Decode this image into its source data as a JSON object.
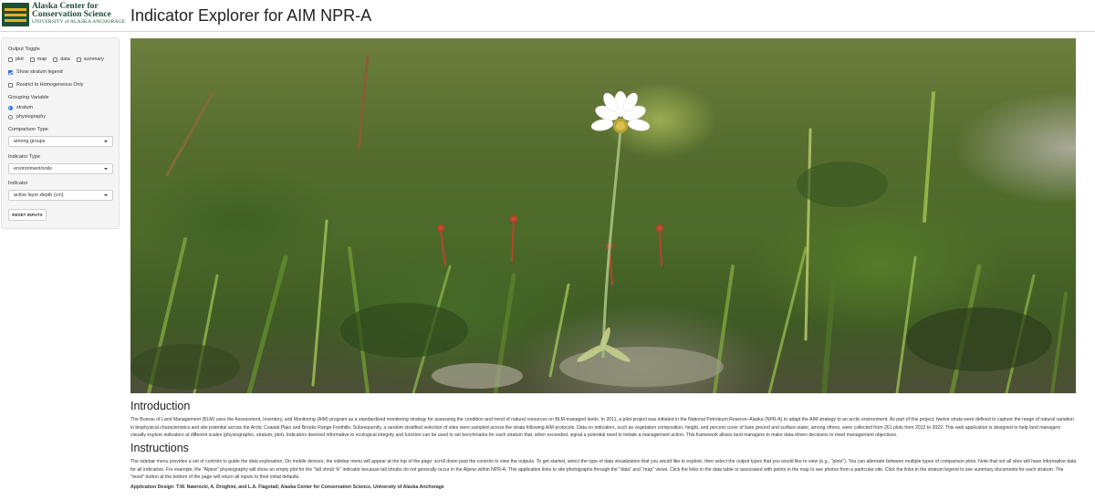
{
  "header": {
    "logo": {
      "mark_text": "UAA",
      "line1": "Alaska Center for",
      "line2": "Conservation Science",
      "line3": "UNIVERSITY of ALASKA ANCHORAGE"
    },
    "title": "Indicator Explorer for AIM NPR-A"
  },
  "sidebar": {
    "output_toggle": {
      "label": "Output Toggle",
      "options": [
        {
          "label": "plot",
          "checked": false
        },
        {
          "label": "map",
          "checked": false
        },
        {
          "label": "data",
          "checked": false
        },
        {
          "label": "summary",
          "checked": false
        }
      ]
    },
    "show_legend": {
      "label": "Show stratum legend",
      "checked": true
    },
    "restrict_homogeneous": {
      "label": "Restrict to Homogeneous Only",
      "checked": false
    },
    "grouping_variable": {
      "label": "Grouping Variable",
      "options": [
        {
          "label": "stratum",
          "selected": true
        },
        {
          "label": "physiography",
          "selected": false
        }
      ]
    },
    "comparison_type": {
      "label": "Comparison Type",
      "value": "among groups"
    },
    "indicator_type": {
      "label": "Indicator Type",
      "value": "environment/soils"
    },
    "indicator": {
      "label": "Indicator",
      "value": "active layer depth (cm)"
    },
    "reset_label": "RESET INPUTS"
  },
  "main": {
    "introduction": {
      "heading": "Introduction",
      "text": "The Bureau of Land Management (BLM) uses the Assessment, Inventory, and Monitoring (AIM) program as a standardized monitoring strategy for assessing the condition and trend of natural resources on BLM-managed lands. In 2011, a pilot project was initiated in the National Petroleum Reserve–Alaska (NPR-A) to adapt the AIM strategy to an arctic environment. As part of this project, twelve strata were defined to capture the range of natural variation in biophysical characteristics and site potential across the Arctic Coastal Plain and Brooks Range Foothills. Subsequently, a random stratified selection of sites were sampled across the strata following AIM protocols. Data on indicators, such as vegetation composition, height, and percent cover of bare ground and surface water, among others, were collected from 261 plots from 2012 to 2022. This web application is designed to help land managers visually explore indicators at different scales (physiographic, stratum, plot). Indicators deemed informative to ecological integrity and function can be used to set benchmarks for each stratum that, when exceeded, signal a potential need to initiate a management action. This framework allows land managers to make data-driven decisions to meet management objectives."
    },
    "instructions": {
      "heading": "Instructions",
      "text": "The sidebar menu provides a set of controls to guide the data exploration. On mobile devices, the sidebar menu will appear at the top of the page: scroll down past the controls to view the outputs. To get started, select the type of data visualization that you would like to explore, then select the output types that you would like to view (e.g., \"plots\"). You can alternate between multiple types of comparison plots. Note that not all sites will have informative data for all indicators. For example, the \"Alpine\" physiography will show an empty plot for the \"tall shrub %\" indicator because tall shrubs do not generally occur in the Alpine within NPR-A. This application links to site photographs through the \"data\" and \"map\" views. Click the links in the data table or associated with points in the map to see photos from a particular site. Click the links in the stratum legend to see summary documents for each stratum. The \"reset\" button at the bottom of the page will return all inputs to their initial defaults."
    },
    "credit": "Application Design: T.W. Nawrocki, A. Droghini, and L.A. Flagstad; Alaska Center for Conservation Science, University of Alaska Anchorage"
  }
}
